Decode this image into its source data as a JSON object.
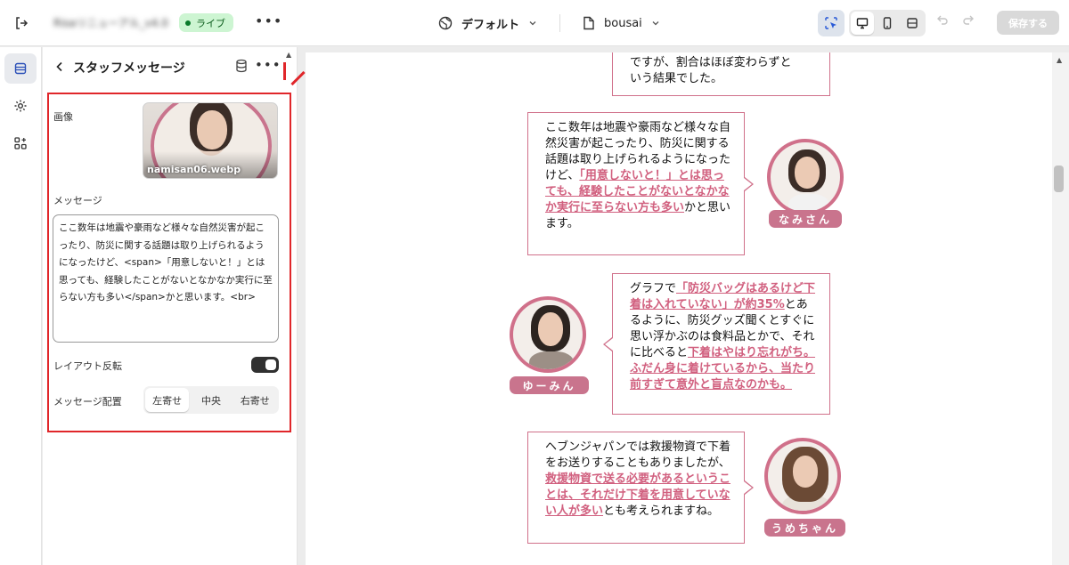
{
  "topbar": {
    "store_name": "Risaリニューアル_v4.0",
    "live_badge": "ライブ",
    "more": "•••",
    "theme": "デフォルト",
    "page": "bousai",
    "save_label": "保存する"
  },
  "panel": {
    "title": "スタッフメッセージ",
    "more": "•••",
    "image_label": "画像",
    "image_file": "namisan06.webp",
    "message_label": "メッセージ",
    "message_value": "ここ数年は地震や豪雨など様々な自然災害が起こったり、防災に関する話題は取り上げられるようになったけど、<span>「用意しないと！」とは思っても、経験したことがないとなかなか実行に至らない方も多い</span>かと思います。<br>",
    "layout_reverse_label": "レイアウト反転",
    "layout_reverse_on": true,
    "alignment_label": "メッセージ配置",
    "alignment_options": [
      "左寄せ",
      "中央",
      "右寄せ"
    ],
    "alignment_selected": "左寄せ"
  },
  "preview": {
    "top_fragment": [
      {
        "text": "ですが、割合はほぼ変わらずと",
        "em": false
      },
      {
        "text": "\nいう結果でした。",
        "em": false
      }
    ],
    "messages": [
      {
        "name": "なみさん",
        "parts": [
          {
            "text": "ここ数年は地震や豪雨など様々な自然災害が起こったり、防災に関する話題は取り上げられるようになったけど、",
            "em": false
          },
          {
            "text": "「用意しないと！」とは思っても、経験したことがないとなかなか実行に至らない方も多い",
            "em": true
          },
          {
            "text": "かと思います。",
            "em": false
          }
        ]
      },
      {
        "name": "ゆーみん",
        "parts": [
          {
            "text": "グラフで",
            "em": false
          },
          {
            "text": "「防災バッグはあるけど下着は入れていない」が約35%",
            "em": true
          },
          {
            "text": "とあるように、防災グッズ聞くとすぐに思い浮かぶのは食料品とかで、それに比べると",
            "em": false
          },
          {
            "text": "下着はやはり忘れがち。ふだん身に着けているから、当たり前すぎて意外と盲点なのかも。",
            "em": true
          }
        ]
      },
      {
        "name": "うめちゃん",
        "parts": [
          {
            "text": "ヘブンジャパンでは救援物資で下着をお送りすることもありましたが、",
            "em": false
          },
          {
            "text": "救援物資で送る必要があるということは、それだけ下着を用意していない人が多い",
            "em": true
          },
          {
            "text": "とも考えられますね。",
            "em": false
          }
        ]
      }
    ]
  }
}
